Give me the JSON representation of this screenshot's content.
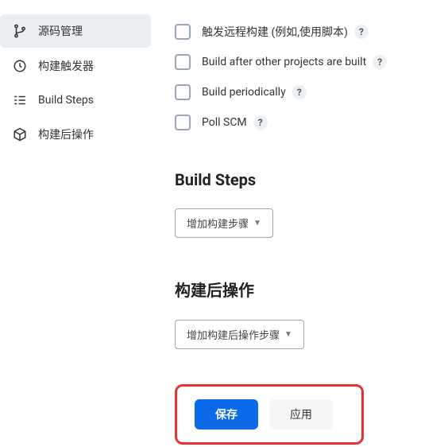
{
  "sidebar": {
    "items": [
      {
        "label": "源码管理"
      },
      {
        "label": "构建触发器"
      },
      {
        "label": "Build Steps"
      },
      {
        "label": "构建后操作"
      }
    ]
  },
  "triggers": {
    "items": [
      {
        "label": "触发远程构建 (例如,使用脚本)"
      },
      {
        "label": "Build after other projects are built"
      },
      {
        "label": "Build periodically"
      },
      {
        "label": "Poll SCM"
      }
    ],
    "help": "?"
  },
  "build_steps": {
    "title": "Build Steps",
    "add_button": "增加构建步骤"
  },
  "post_build": {
    "title": "构建后操作",
    "add_button": "增加构建后操作步骤"
  },
  "actions": {
    "save": "保存",
    "apply": "应用"
  },
  "caret": "▼"
}
